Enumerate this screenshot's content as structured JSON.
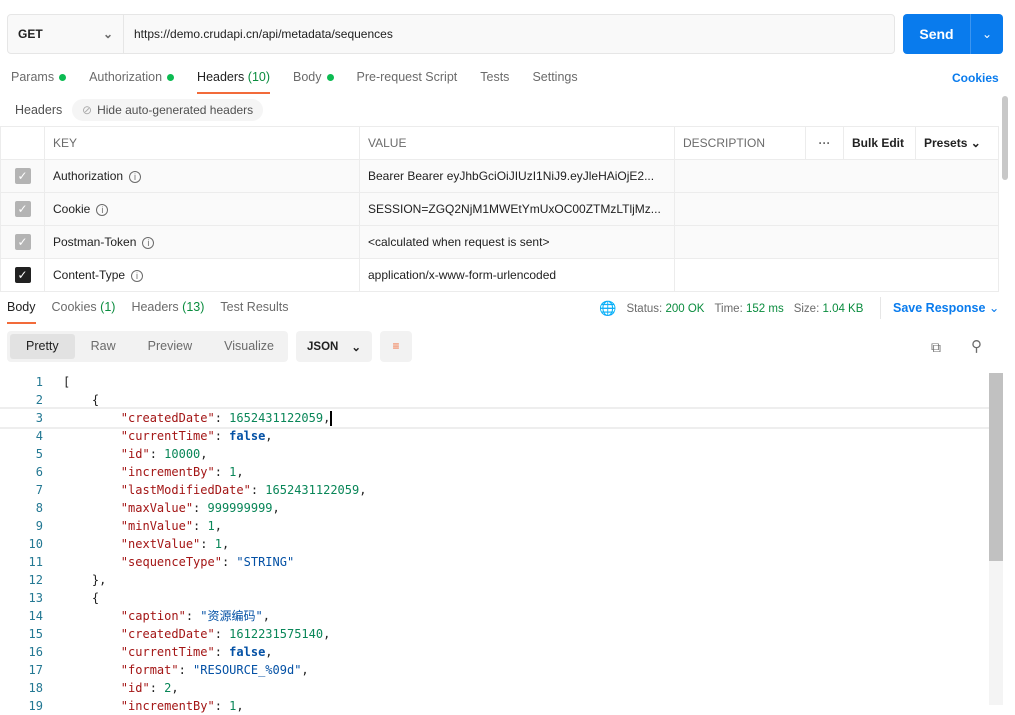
{
  "request": {
    "method": "GET",
    "url": "https://demo.crudapi.cn/api/metadata/sequences",
    "send": "Send"
  },
  "tabs": [
    {
      "label": "Params",
      "dot": true
    },
    {
      "label": "Authorization",
      "dot": true
    },
    {
      "label": "Headers",
      "count": "(10)",
      "active": true
    },
    {
      "label": "Body",
      "dot": true
    },
    {
      "label": "Pre-request Script"
    },
    {
      "label": "Tests"
    },
    {
      "label": "Settings"
    }
  ],
  "cookies_link": "Cookies",
  "headers_label": "Headers",
  "hide_auto": "Hide auto-generated headers",
  "table": {
    "columns": [
      "KEY",
      "VALUE",
      "DESCRIPTION"
    ],
    "more": "ooo",
    "bulk_edit": "Bulk Edit",
    "presets": "Presets",
    "rows": [
      {
        "key": "Authorization",
        "value": "Bearer Bearer eyJhbGciOiJIUzI1NiJ9.eyJleHAiOjE2...",
        "checked": true,
        "auto": true
      },
      {
        "key": "Cookie",
        "value": "SESSION=ZGQ2NjM1MWEtYmUxOC00ZTMzLTljMz...",
        "checked": true,
        "auto": true
      },
      {
        "key": "Postman-Token",
        "value": "<calculated when request is sent>",
        "checked": true,
        "auto": true
      },
      {
        "key": "Content-Type",
        "value": "application/x-www-form-urlencoded",
        "checked": true,
        "auto": false
      }
    ]
  },
  "response": {
    "tabs": [
      {
        "label": "Body",
        "active": true
      },
      {
        "label": "Cookies",
        "count": "(1)"
      },
      {
        "label": "Headers",
        "count": "(13)"
      },
      {
        "label": "Test Results"
      }
    ],
    "status_label": "Status:",
    "status": "200 OK",
    "time_label": "Time:",
    "time": "152 ms",
    "size_label": "Size:",
    "size": "1.04 KB",
    "save": "Save Response",
    "views": [
      "Pretty",
      "Raw",
      "Preview",
      "Visualize"
    ],
    "active_view": "Pretty",
    "format": "JSON"
  },
  "code_lines": [
    [
      [
        "p",
        "["
      ]
    ],
    [
      [
        "p",
        "    {"
      ]
    ],
    [
      [
        "p",
        "        "
      ],
      [
        "k",
        "\"createdDate\""
      ],
      [
        "p",
        ": "
      ],
      [
        "n",
        "1652431122059"
      ],
      [
        "p",
        ","
      ]
    ],
    [
      [
        "p",
        "        "
      ],
      [
        "k",
        "\"currentTime\""
      ],
      [
        "p",
        ": "
      ],
      [
        "b",
        "false"
      ],
      [
        "p",
        ","
      ]
    ],
    [
      [
        "p",
        "        "
      ],
      [
        "k",
        "\"id\""
      ],
      [
        "p",
        ": "
      ],
      [
        "n",
        "10000"
      ],
      [
        "p",
        ","
      ]
    ],
    [
      [
        "p",
        "        "
      ],
      [
        "k",
        "\"incrementBy\""
      ],
      [
        "p",
        ": "
      ],
      [
        "n",
        "1"
      ],
      [
        "p",
        ","
      ]
    ],
    [
      [
        "p",
        "        "
      ],
      [
        "k",
        "\"lastModifiedDate\""
      ],
      [
        "p",
        ": "
      ],
      [
        "n",
        "1652431122059"
      ],
      [
        "p",
        ","
      ]
    ],
    [
      [
        "p",
        "        "
      ],
      [
        "k",
        "\"maxValue\""
      ],
      [
        "p",
        ": "
      ],
      [
        "n",
        "999999999"
      ],
      [
        "p",
        ","
      ]
    ],
    [
      [
        "p",
        "        "
      ],
      [
        "k",
        "\"minValue\""
      ],
      [
        "p",
        ": "
      ],
      [
        "n",
        "1"
      ],
      [
        "p",
        ","
      ]
    ],
    [
      [
        "p",
        "        "
      ],
      [
        "k",
        "\"nextValue\""
      ],
      [
        "p",
        ": "
      ],
      [
        "n",
        "1"
      ],
      [
        "p",
        ","
      ]
    ],
    [
      [
        "p",
        "        "
      ],
      [
        "k",
        "\"sequenceType\""
      ],
      [
        "p",
        ": "
      ],
      [
        "s",
        "\"STRING\""
      ]
    ],
    [
      [
        "p",
        "    },"
      ]
    ],
    [
      [
        "p",
        "    {"
      ]
    ],
    [
      [
        "p",
        "        "
      ],
      [
        "k",
        "\"caption\""
      ],
      [
        "p",
        ": "
      ],
      [
        "s",
        "\"资源编码\""
      ],
      [
        "p",
        ","
      ]
    ],
    [
      [
        "p",
        "        "
      ],
      [
        "k",
        "\"createdDate\""
      ],
      [
        "p",
        ": "
      ],
      [
        "n",
        "1612231575140"
      ],
      [
        "p",
        ","
      ]
    ],
    [
      [
        "p",
        "        "
      ],
      [
        "k",
        "\"currentTime\""
      ],
      [
        "p",
        ": "
      ],
      [
        "b",
        "false"
      ],
      [
        "p",
        ","
      ]
    ],
    [
      [
        "p",
        "        "
      ],
      [
        "k",
        "\"format\""
      ],
      [
        "p",
        ": "
      ],
      [
        "s",
        "\"RESOURCE_%09d\""
      ],
      [
        "p",
        ","
      ]
    ],
    [
      [
        "p",
        "        "
      ],
      [
        "k",
        "\"id\""
      ],
      [
        "p",
        ": "
      ],
      [
        "n",
        "2"
      ],
      [
        "p",
        ","
      ]
    ],
    [
      [
        "p",
        "        "
      ],
      [
        "k",
        "\"incrementBy\""
      ],
      [
        "p",
        ": "
      ],
      [
        "n",
        "1"
      ],
      [
        "p",
        ","
      ]
    ]
  ]
}
